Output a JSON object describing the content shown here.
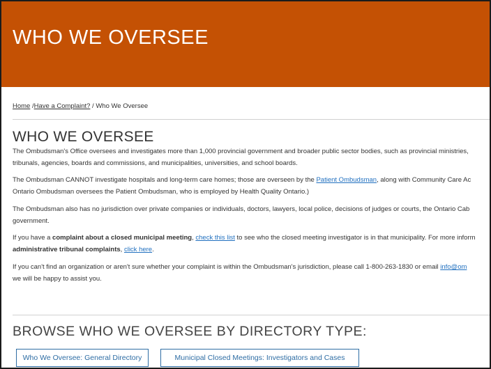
{
  "hero": {
    "title": "WHO WE OVERSEE",
    "color": "#c45104"
  },
  "breadcrumb": {
    "home": "Home",
    "sep1": " /",
    "complaint": "Have a Complaint?",
    "sep2": " / ",
    "current": "Who We Oversee"
  },
  "main": {
    "title": "WHO WE OVERSEE",
    "p1": {
      "line1": "The Ombudsman's Office oversees and investigates more than 1,000 provincial government and broader public sector bodies, such as provincial ministries,",
      "line2": "tribunals, agencies, boards and commissions, and municipalities, universities, and school boards."
    },
    "p2": {
      "line1_pre": "The Ombudsman CANNOT investigate hospitals and long-term care homes; those are overseen by the ",
      "link": "Patient Ombudsman",
      "line1_post": ", along with Community Care Ac",
      "line2": "Ontario Ombudsman oversees the Patient Ombudsman, who is employed by Health Quality Ontario.)"
    },
    "p3": {
      "line1": "The Ombudsman also has no jurisdiction over private companies or individuals, doctors, lawyers, local police, decisions of judges or courts, the Ontario Cab",
      "line2": "government."
    },
    "p4": {
      "pre": "If you have a ",
      "bold": "complaint about a closed municipal meeting",
      "comma": ", ",
      "link": "check this list",
      "post": " to see who the closed meeting investigator is in that municipality. For more inform",
      "bold2": "administrative tribunal complaints",
      "comma2": ", ",
      "link2": "click here",
      "end": "."
    },
    "p5": {
      "pre": "If you can't find an organization or aren't sure whether your complaint is within the Ombudsman's jurisdiction, please call 1-800-263-1830 or email ",
      "link": "info@om",
      "line2": "we will be happy to assist you."
    }
  },
  "browse": {
    "title": "BROWSE WHO WE OVERSEE BY DIRECTORY TYPE:",
    "buttons": [
      "Who We Oversee: General Directory",
      "Municipal Closed Meetings: Investigators and Cases"
    ]
  }
}
